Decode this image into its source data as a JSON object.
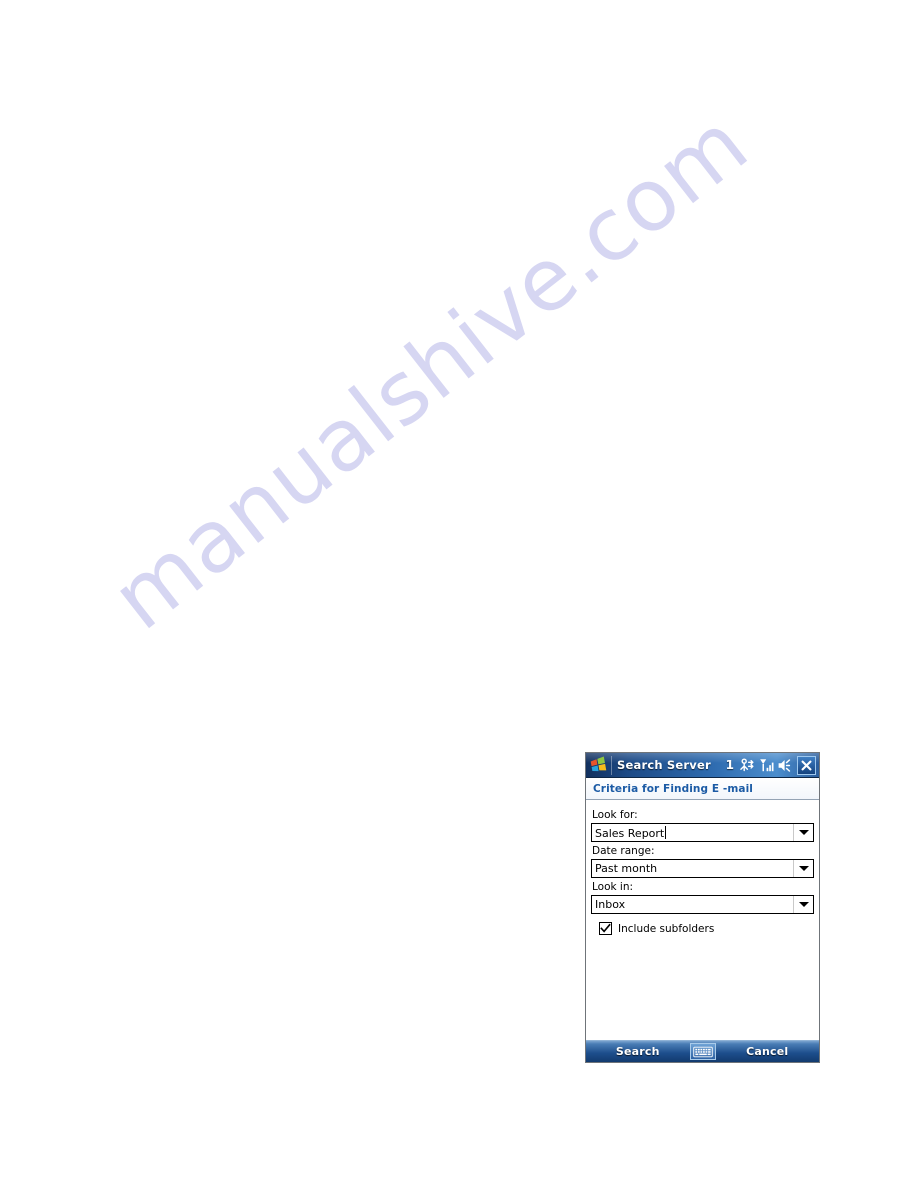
{
  "page": {
    "watermark": "manualshive.com",
    "background_color": "#ffffff"
  },
  "device": {
    "titlebar": {
      "start_icon": "windows-flag-icon",
      "title": "Search Server",
      "notification_count": "1",
      "icons": [
        "connectivity-icon",
        "signal-strength-icon",
        "speaker-icon"
      ],
      "close_label": "X",
      "gradient_start": "#12305e",
      "gradient_end": "#4b8dcd"
    },
    "section_header": {
      "title": "Criteria for Finding E -mail",
      "color": "#1c5ba5"
    },
    "form": {
      "fields": [
        {
          "label": "Look for:",
          "value": "Sales Report",
          "type": "combo-editable",
          "has_caret": true
        },
        {
          "label": "Date range:",
          "value": "Past month",
          "type": "combo",
          "has_caret": false
        },
        {
          "label": "Look in:",
          "value": "Inbox",
          "type": "combo",
          "has_caret": false
        }
      ],
      "checkbox": {
        "label": "Include subfolders",
        "checked": true
      }
    },
    "softbar": {
      "left_label": "Search",
      "sip_icon": "keyboard-icon",
      "right_label": "Cancel"
    }
  }
}
